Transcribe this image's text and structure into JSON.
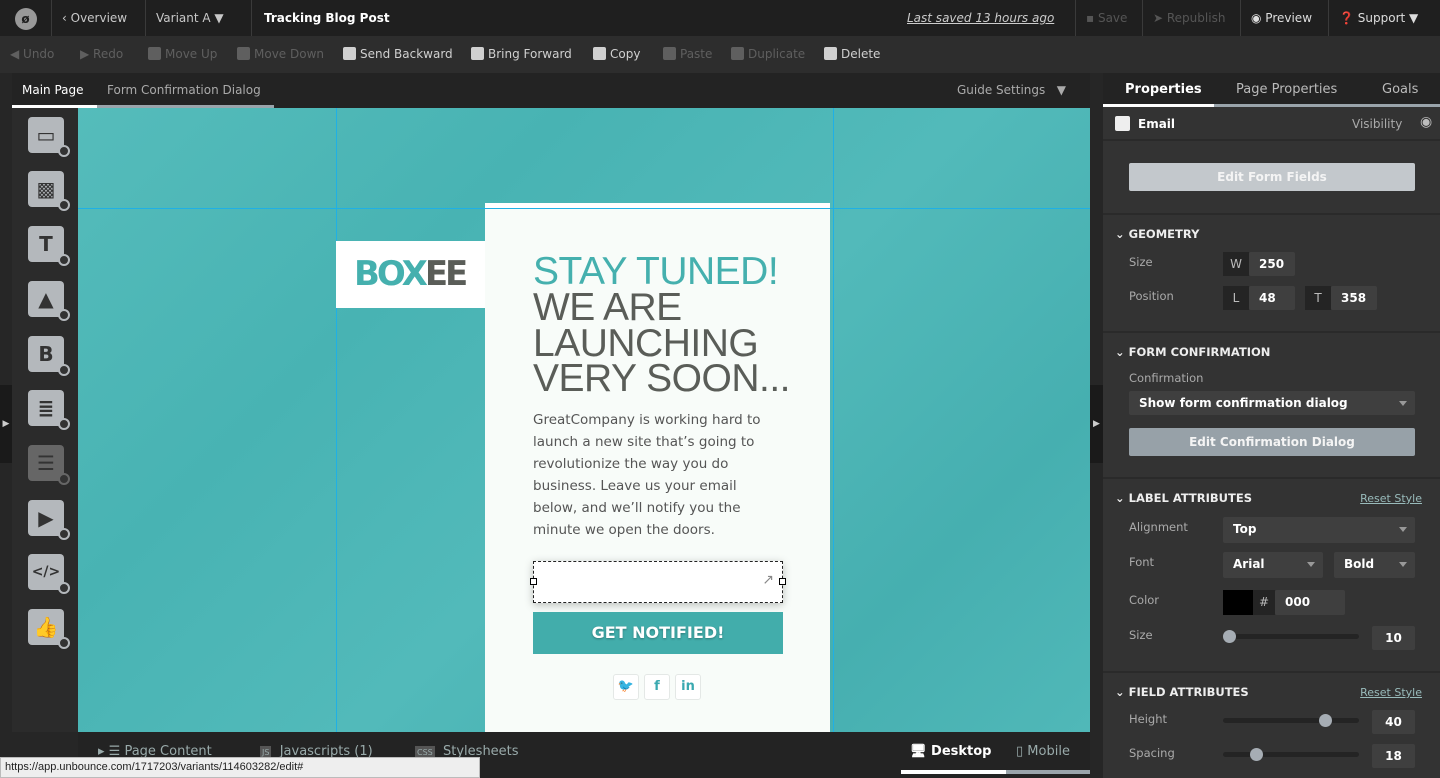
{
  "topbar": {
    "overview": "Overview",
    "variant": "Variant A",
    "page_name": "Tracking Blog Post",
    "last_saved": "Last saved  13 hours ago",
    "save": "Save",
    "republish": "Republish",
    "preview": "Preview",
    "support": "Support"
  },
  "toolbar": {
    "undo": "Undo",
    "redo": "Redo",
    "move_up": "Move Up",
    "move_down": "Move Down",
    "send_backward": "Send Backward",
    "bring_forward": "Bring Forward",
    "copy": "Copy",
    "paste": "Paste",
    "duplicate": "Duplicate",
    "delete": "Delete"
  },
  "canvas_tabs": {
    "main": "Main Page",
    "dialog": "Form Confirmation Dialog",
    "guide_settings": "Guide Settings"
  },
  "page": {
    "logo": "BOXEE",
    "logo_box": "BOX",
    "logo_ee": "EE",
    "h1_teal": "STAY TUNED!",
    "h1_lines": [
      "WE ARE",
      "LAUNCHING",
      "VERY SOON..."
    ],
    "body": "GreatCompany is working hard to launch a new site that’s going to revolutionize the way you do business. Leave us your email below, and we’ll notify you the minute we open the doors.",
    "cta": "GET NOTIFIED!",
    "social": [
      "twitter",
      "facebook",
      "linkedin"
    ],
    "social_glyphs": [
      "🐦",
      "f",
      "in"
    ]
  },
  "colors": {
    "teal": "#48b3b3",
    "accent": "#42adab",
    "dark_text": "#5a5d58"
  },
  "bottom": {
    "page_content": "Page Content",
    "javascripts": "Javascripts (1)",
    "stylesheets": "Stylesheets",
    "desktop": "Desktop",
    "mobile": "Mobile"
  },
  "status_url": "https://app.unbounce.com/1717203/variants/114603282/edit#",
  "right": {
    "tabs": [
      "Properties",
      "Page Properties",
      "Goals"
    ],
    "element": "Email",
    "visibility": "Visibility",
    "edit_form_fields": "Edit Form Fields",
    "geometry": {
      "title": "GEOMETRY",
      "size_label": "Size",
      "position_label": "Position",
      "w_label": "W",
      "w": "250",
      "l_label": "L",
      "l": "48",
      "t_label": "T",
      "t": "358"
    },
    "form_conf": {
      "title": "FORM CONFIRMATION",
      "label": "Confirmation",
      "value": "Show form confirmation dialog",
      "edit": "Edit Confirmation Dialog"
    },
    "label_attr": {
      "title": "LABEL ATTRIBUTES",
      "reset": "Reset Style",
      "alignment_label": "Alignment",
      "alignment": "Top",
      "font_label": "Font",
      "font": "Arial",
      "weight": "Bold",
      "color_label": "Color",
      "hash": "#",
      "color": "000",
      "size_label": "Size",
      "size": "10"
    },
    "field_attr": {
      "title": "FIELD ATTRIBUTES",
      "reset": "Reset Style",
      "height_label": "Height",
      "height": "40",
      "spacing_label": "Spacing",
      "spacing": "18"
    }
  }
}
